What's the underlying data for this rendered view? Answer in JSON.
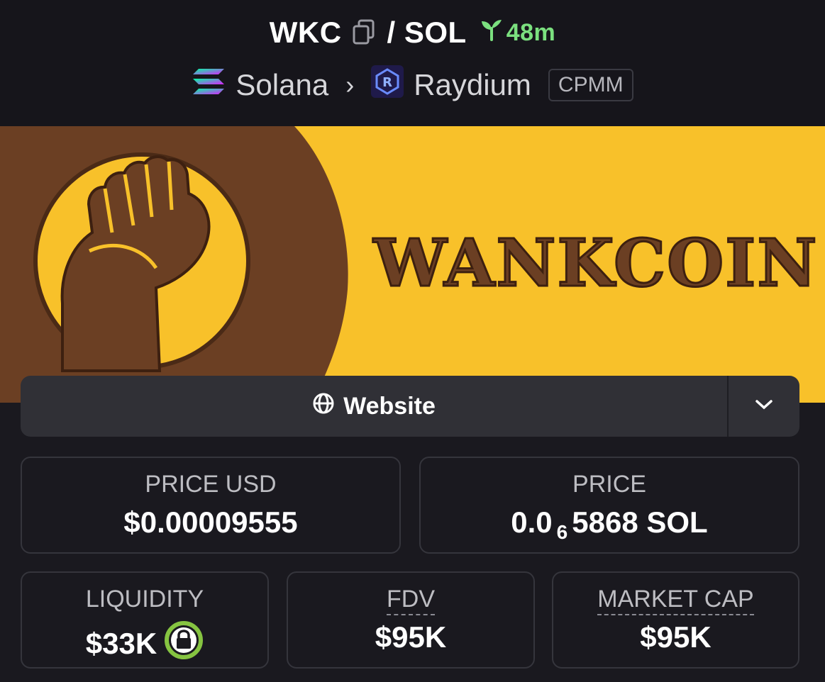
{
  "header": {
    "base_symbol": "WKC",
    "quote_symbol": "/ SOL",
    "age": "48m",
    "chain": "Solana",
    "dex": "Raydium",
    "pool_type": "CPMM"
  },
  "banner": {
    "brand_text": "WANKCOIN"
  },
  "links": {
    "website_label": "Website"
  },
  "stats": {
    "price_usd": {
      "label": "PRICE USD",
      "value": "$0.00009555"
    },
    "price": {
      "label": "PRICE",
      "value_prefix": "0.0",
      "zeros_subscript": "6",
      "value_suffix": "5868 SOL"
    },
    "liquidity": {
      "label": "LIQUIDITY",
      "value": "$33K"
    },
    "fdv": {
      "label": "FDV",
      "value": "$95K"
    },
    "market_cap": {
      "label": "MARKET CAP",
      "value": "$95K"
    }
  },
  "colors": {
    "background": "#1a191f",
    "banner_yellow": "#f8c12a",
    "banner_brown": "#6b3f23",
    "age_green": "#7be07f",
    "lock_ring": "#86c441"
  }
}
